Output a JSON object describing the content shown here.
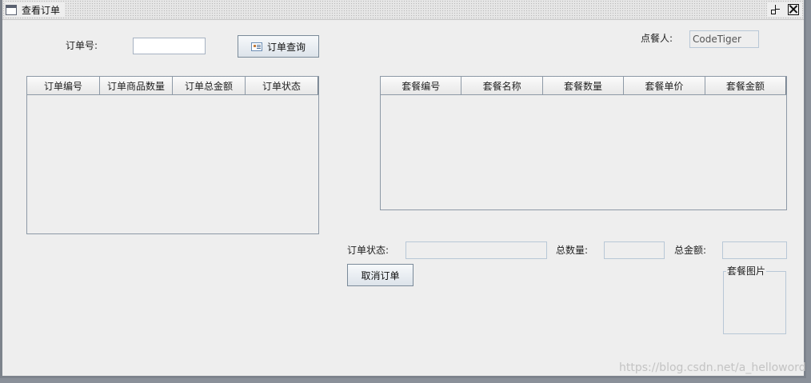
{
  "window": {
    "title": "查看订单",
    "icons": {
      "app": "window-icon",
      "restore": "restore-icon",
      "close": "close-icon"
    }
  },
  "query": {
    "order_no_label": "订单号:",
    "order_no_value": "",
    "search_button_label": "订单查询",
    "search_button_icon": "document-icon"
  },
  "customer": {
    "label": "点餐人:",
    "value": "CodeTiger"
  },
  "orders_table": {
    "columns": [
      "订单编号",
      "订单商品数量",
      "订单总金额",
      "订单状态"
    ],
    "rows": []
  },
  "packages_table": {
    "columns": [
      "套餐编号",
      "套餐名称",
      "套餐数量",
      "套餐单价",
      "套餐金额"
    ],
    "rows": []
  },
  "summary": {
    "status_label": "订单状态:",
    "status_value": "",
    "total_qty_label": "总数量:",
    "total_qty_value": "",
    "total_amount_label": "总金额:",
    "total_amount_value": ""
  },
  "actions": {
    "cancel_order_label": "取消订单"
  },
  "package_image": {
    "legend": "套餐图片"
  },
  "watermark": "https://blog.csdn.net/a_helloword",
  "colors": {
    "window_bg": "#eeeeee",
    "frame": "#7d838c",
    "table_border": "#8d99a6",
    "field_border": "#b8c7d6"
  }
}
